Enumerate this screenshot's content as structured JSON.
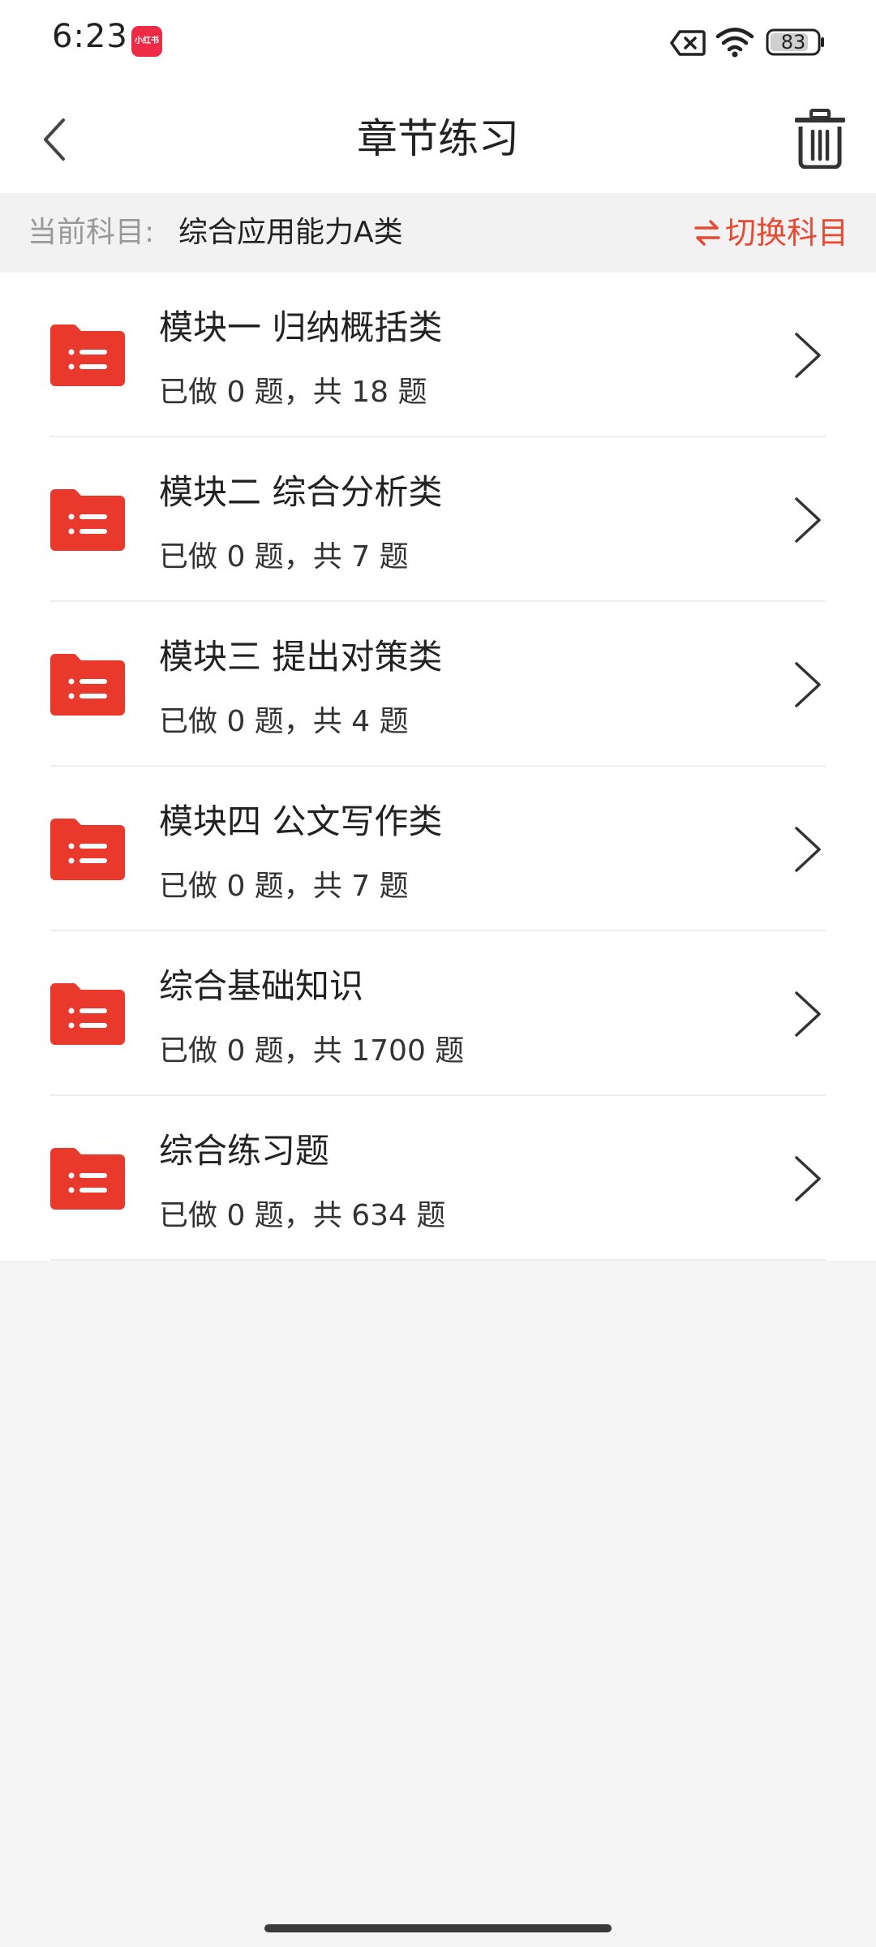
{
  "status_bar": {
    "time": "6:23",
    "app_badge": "小红书",
    "battery": "83"
  },
  "header": {
    "title": "章节练习",
    "back_icon": "chevron-left-icon",
    "delete_icon": "trash-icon"
  },
  "subject": {
    "label": "当前科目:",
    "value": "综合应用能力A类",
    "switch_label": "切换科目",
    "switch_icon": "swap-arrows-icon"
  },
  "chapters": [
    {
      "title": "模块一 归纳概括类",
      "progress": "已做 0 题，共 18 题"
    },
    {
      "title": "模块二 综合分析类",
      "progress": "已做 0 题，共 7 题"
    },
    {
      "title": "模块三 提出对策类",
      "progress": "已做 0 题，共 4 题"
    },
    {
      "title": "模块四 公文写作类",
      "progress": "已做 0 题，共 7 题"
    },
    {
      "title": "综合基础知识",
      "progress": "已做 0 题，共 1700 题"
    },
    {
      "title": "综合练习题",
      "progress": "已做 0 题，共 634 题"
    }
  ],
  "colors": {
    "accent": "#e84a32",
    "folder": "#e8392c",
    "background": "#f5f5f5"
  }
}
